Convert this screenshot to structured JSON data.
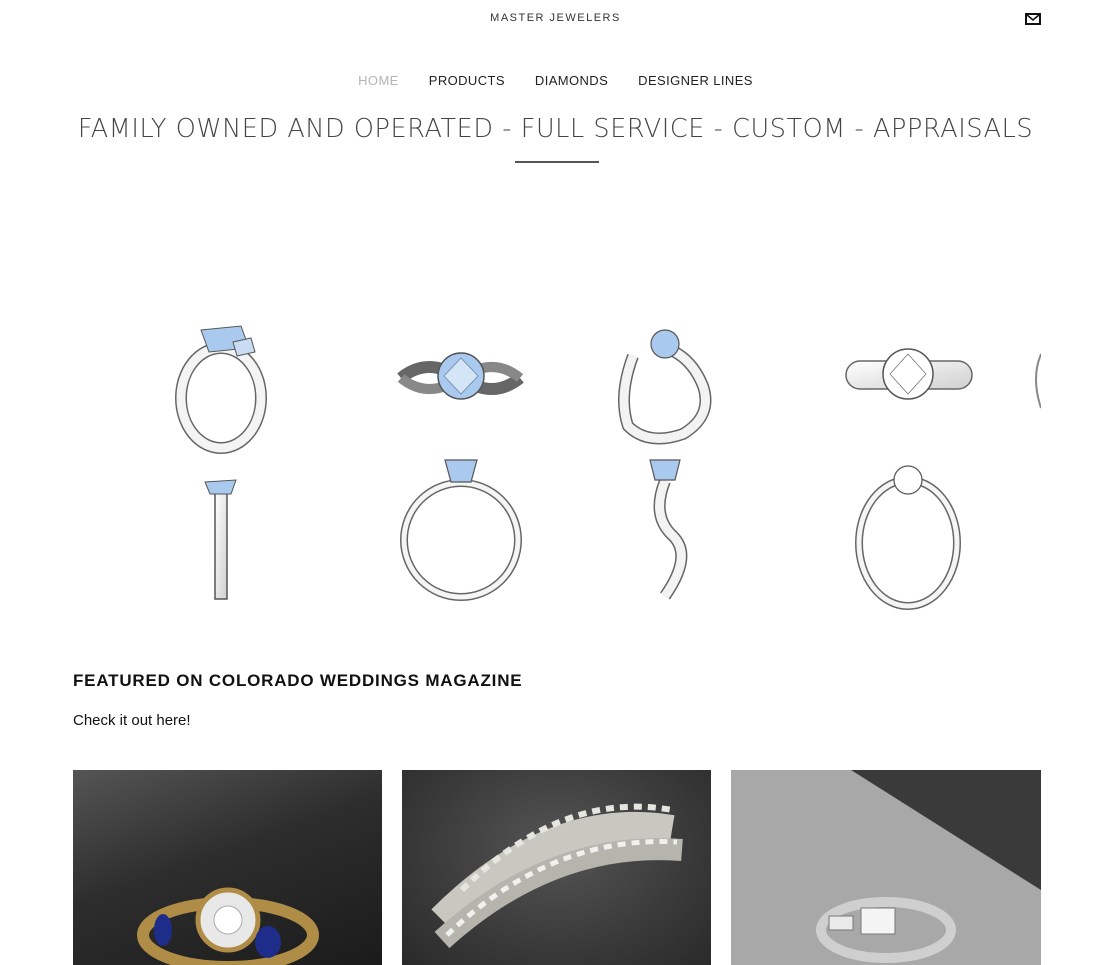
{
  "header": {
    "brand": "MASTER JEWELERS",
    "mail_icon": "envelope-icon"
  },
  "nav": {
    "items": [
      {
        "label": "HOME",
        "active": true
      },
      {
        "label": "PRODUCTS",
        "active": false
      },
      {
        "label": "DIAMONDS",
        "active": false
      },
      {
        "label": "DESIGNER LINES",
        "active": false
      }
    ]
  },
  "hero": {
    "title": "FAMILY OWNED AND OPERATED - FULL SERVICE - CUSTOM - APPRAISALS"
  },
  "featured": {
    "heading": "FEATURED ON COLORADO WEDDINGS MAGAZINE",
    "link": "Check it out here!"
  },
  "colors": {
    "nav_active": "#b5b5b5",
    "gem_blue": "#a9c9ee",
    "metal": "#f2f2f2",
    "outline": "#555555"
  }
}
